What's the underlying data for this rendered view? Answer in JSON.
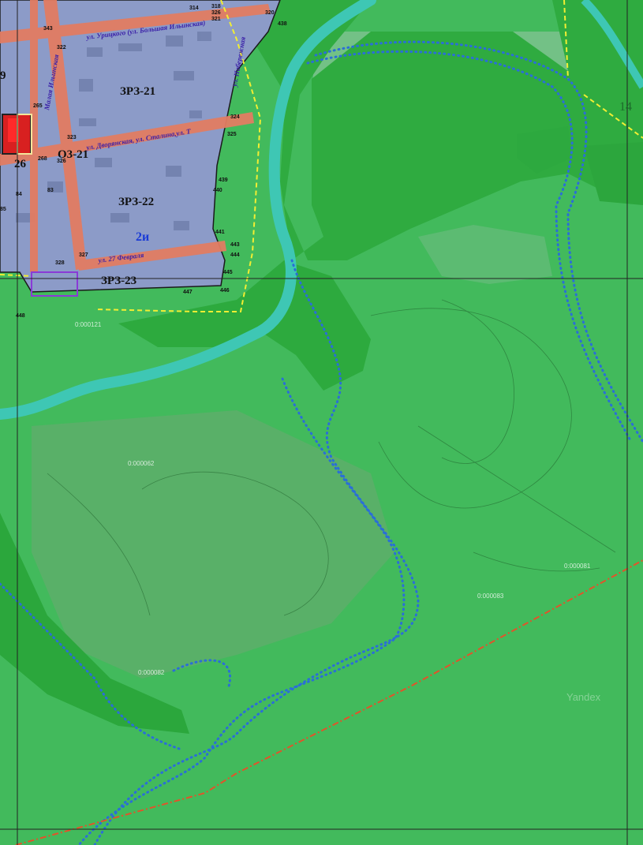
{
  "zones": [
    {
      "id": "zone-zrz21",
      "label": "ЗРЗ-21"
    },
    {
      "id": "zone-zrz22",
      "label": "ЗРЗ-22"
    },
    {
      "id": "zone-zrz23",
      "label": "ЗРЗ-23"
    },
    {
      "id": "zone-o321",
      "label": "О3-21"
    }
  ],
  "markers": {
    "block_26": "26",
    "block_2i": "2и",
    "edge_9": "9",
    "edge_14": "14"
  },
  "streets": [
    "ул. Урицкого (ул. Большая Ильинская)",
    "ул. Дворянская, ул. Сталина,ул. Т",
    "ул. 27 Февраля",
    "ул. Набережная",
    "Малая Ильинская"
  ],
  "point_numbers": [
    "314",
    "318",
    "320",
    "321",
    "438",
    "325",
    "324",
    "439",
    "440",
    "441",
    "443",
    "444",
    "445",
    "446",
    "447",
    "448",
    "265",
    "268",
    "326",
    "323",
    "322",
    "83",
    "84",
    "85",
    "327",
    "328",
    "343",
    "326"
  ],
  "parcel_codes": [
    "0:000062",
    "0:000082",
    "0:000083",
    "0:000081",
    "0:000121"
  ],
  "watermark": "Yandex",
  "colors": {
    "water": "#3ec7b4",
    "forest": "#2faa3f",
    "meadow": "#45bd5e",
    "pale": "#7cc48f",
    "urban": "#8d9dc7",
    "road": "#e07d62",
    "boundary": "#1a1a1a",
    "dotline": "#2a6fd6",
    "redline": "#e2532a",
    "yellow": "#f2ee33",
    "violet": "#8a3ad6"
  }
}
